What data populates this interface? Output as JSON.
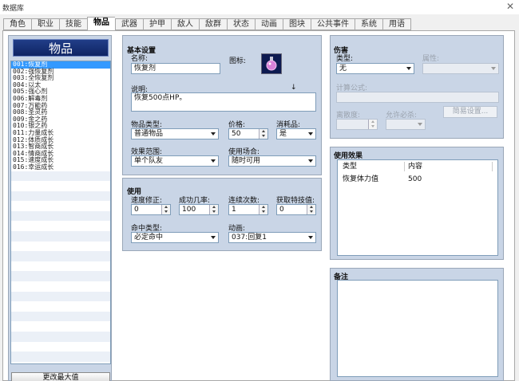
{
  "window": {
    "title": "数据库"
  },
  "tabs": [
    "角色",
    "职业",
    "技能",
    "物品",
    "武器",
    "护甲",
    "敌人",
    "敌群",
    "状态",
    "动画",
    "图块",
    "公共事件",
    "系统",
    "用语"
  ],
  "active_tab": "物品",
  "item_list": {
    "title": "物品",
    "items": [
      "001:恢复剂",
      "002:强恢复剂",
      "003:全恢复剂",
      "004:以太",
      "005:强心剂",
      "006:解毒剂",
      "007:万能药",
      "008:圣灵药",
      "009:金之药",
      "010:银之药",
      "011:力量成长",
      "012:体质成长",
      "013:智商成长",
      "014:情商成长",
      "015:速度成长",
      "016:幸运成长"
    ],
    "selected_index": 0,
    "max_button": "更改最大值"
  },
  "basic": {
    "section": "基本设置",
    "name_label": "名称:",
    "name_value": "恢复剂",
    "icon_label": "图标:",
    "icon_name": "potion-icon",
    "desc_label": "说明:",
    "desc_value": "恢复500点HP。",
    "desc_marker": "↓",
    "type_label": "物品类型:",
    "type_value": "普通物品",
    "price_label": "价格:",
    "price_value": "50",
    "consumable_label": "消耗品:",
    "consumable_value": "是",
    "scope_label": "效果范围:",
    "scope_value": "单个队友",
    "occasion_label": "使用场合:",
    "occasion_value": "随时可用"
  },
  "invocation": {
    "section": "使用",
    "speed_label": "速度修正:",
    "speed_value": "0",
    "success_label": "成功几率:",
    "success_value": "100",
    "repeat_label": "连续次数:",
    "repeat_value": "1",
    "tp_label": "获取特技值:",
    "tp_value": "0",
    "hit_label": "命中类型:",
    "hit_value": "必定命中",
    "anim_label": "动画:",
    "anim_value": "037:回复1"
  },
  "damage": {
    "section": "伤害",
    "type_label": "类型:",
    "type_value": "无",
    "element_label": "属性:",
    "formula_label": "计算公式:",
    "variance_label": "离散度:",
    "critical_label": "允许必杀:",
    "simple_button": "简易设置..."
  },
  "effects": {
    "section": "使用效果",
    "headers": [
      "类型",
      "内容"
    ],
    "rows": [
      [
        "恢复体力值",
        "500"
      ]
    ]
  },
  "note": {
    "section": "备注",
    "value": ""
  },
  "colors": {
    "panel": "#c9d5e6",
    "selection": "#3399ff",
    "title_bg": "#1a357c"
  }
}
